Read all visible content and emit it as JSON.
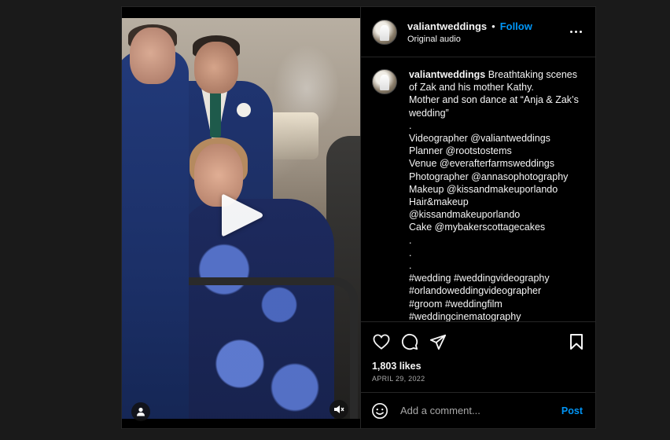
{
  "header": {
    "username": "valiantweddings",
    "separator": "•",
    "follow_label": "Follow",
    "audio_label": "Original audio"
  },
  "caption": {
    "username": "valiantweddings",
    "lines": [
      " Breathtaking scenes of Zak and his mother Kathy.",
      "Mother and son dance at “Anja & Zak’s wedding”",
      ".",
      "Videographer @valiantweddings",
      "Planner @rootstostems",
      "Venue @everafterfarmsweddings",
      "Photographer @annasophotography",
      "Makeup @kissandmakeuporlando",
      "Hair&makeup",
      "@kissandmakeuporlando",
      "Cake @mybakerscottagecakes",
      ".",
      ".",
      ".",
      "#wedding #weddingvideography",
      "#orlandoweddingvideographer",
      "#groom #weddingfilm",
      "#weddingcinematography"
    ]
  },
  "stats": {
    "likes": "1,803 likes",
    "date": "APRIL 29, 2022"
  },
  "comment": {
    "placeholder": "Add a comment...",
    "post_label": "Post"
  },
  "icons": {
    "play": "play-icon",
    "user_tag": "user-icon",
    "mute": "speaker-muted-icon",
    "more": "more-horizontal-icon",
    "like": "heart-icon",
    "comment": "comment-icon",
    "share": "paper-plane-icon",
    "save": "bookmark-icon",
    "emoji": "smiley-icon"
  },
  "colors": {
    "accent": "#0095f6",
    "background": "#000000",
    "border": "#262626",
    "secondary_text": "#a8a8a8"
  }
}
